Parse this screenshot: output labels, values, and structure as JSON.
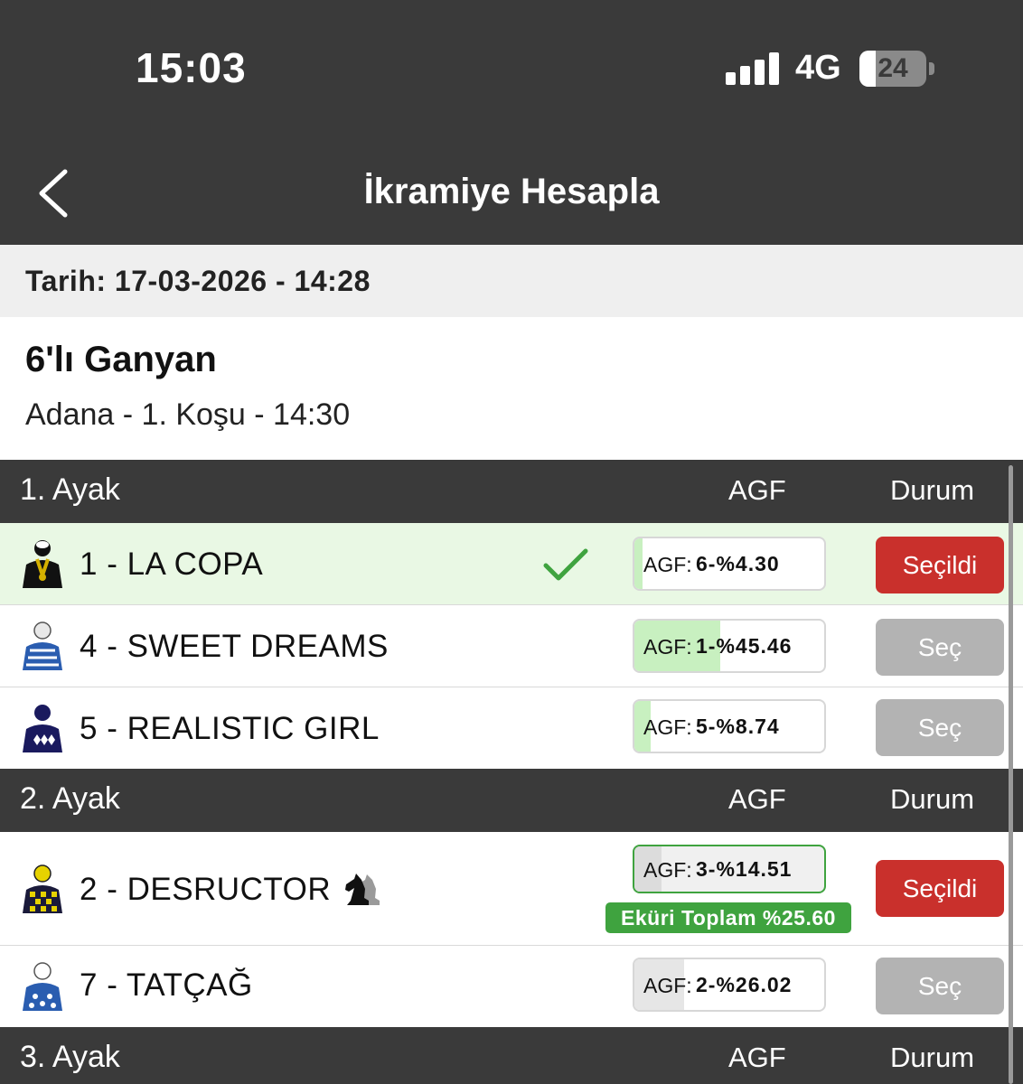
{
  "status_bar": {
    "time": "15:03",
    "network": "4G",
    "battery": "24",
    "battery_fraction": 0.24
  },
  "header": {
    "title": "İkramiye Hesapla"
  },
  "date_line": "Tarih: 17-03-2026 - 14:28",
  "bet": {
    "type": "6'lı Ganyan",
    "race": "Adana - 1. Koşu - 14:30"
  },
  "colors": {
    "header_bg": "#3a3a3a",
    "selected_btn": "#c9302c",
    "unselected_btn": "#b3b3b3",
    "accent_green": "#3fa33f",
    "selected_row": "#e9f8e4"
  },
  "legs": [
    {
      "title": "1. Ayak",
      "agf_header": "AGF",
      "status_header": "Durum",
      "horses": [
        {
          "name": "1 - LA COPA",
          "agf_label": "AGF:",
          "agf_value": "6-%4.30",
          "agf_percent": 4.3,
          "button": "Seçildi",
          "selected": true,
          "icon": "check-icon"
        },
        {
          "name": "4 - SWEET DREAMS",
          "agf_label": "AGF:",
          "agf_value": "1-%45.46",
          "agf_percent": 45.46,
          "button": "Seç",
          "selected": false
        },
        {
          "name": "5 - REALISTIC GIRL",
          "agf_label": "AGF:",
          "agf_value": "5-%8.74",
          "agf_percent": 8.74,
          "button": "Seç",
          "selected": false
        }
      ]
    },
    {
      "title": "2. Ayak",
      "agf_header": "AGF",
      "status_header": "Durum",
      "horses": [
        {
          "name": "2 - DESRUCTOR",
          "agf_label": "AGF:",
          "agf_value": "3-%14.51",
          "agf_percent": 14.51,
          "button": "Seçildi",
          "selected": true,
          "badge": "Eküri Toplam %25.60",
          "icon": "knight-icon"
        },
        {
          "name": "7 - TATÇAĞ",
          "agf_label": "AGF:",
          "agf_value": "2-%26.02",
          "agf_percent": 26.02,
          "button": "Seç",
          "selected": false
        }
      ]
    },
    {
      "title": "3. Ayak",
      "agf_header": "AGF",
      "status_header": "Durum",
      "horses": []
    }
  ]
}
